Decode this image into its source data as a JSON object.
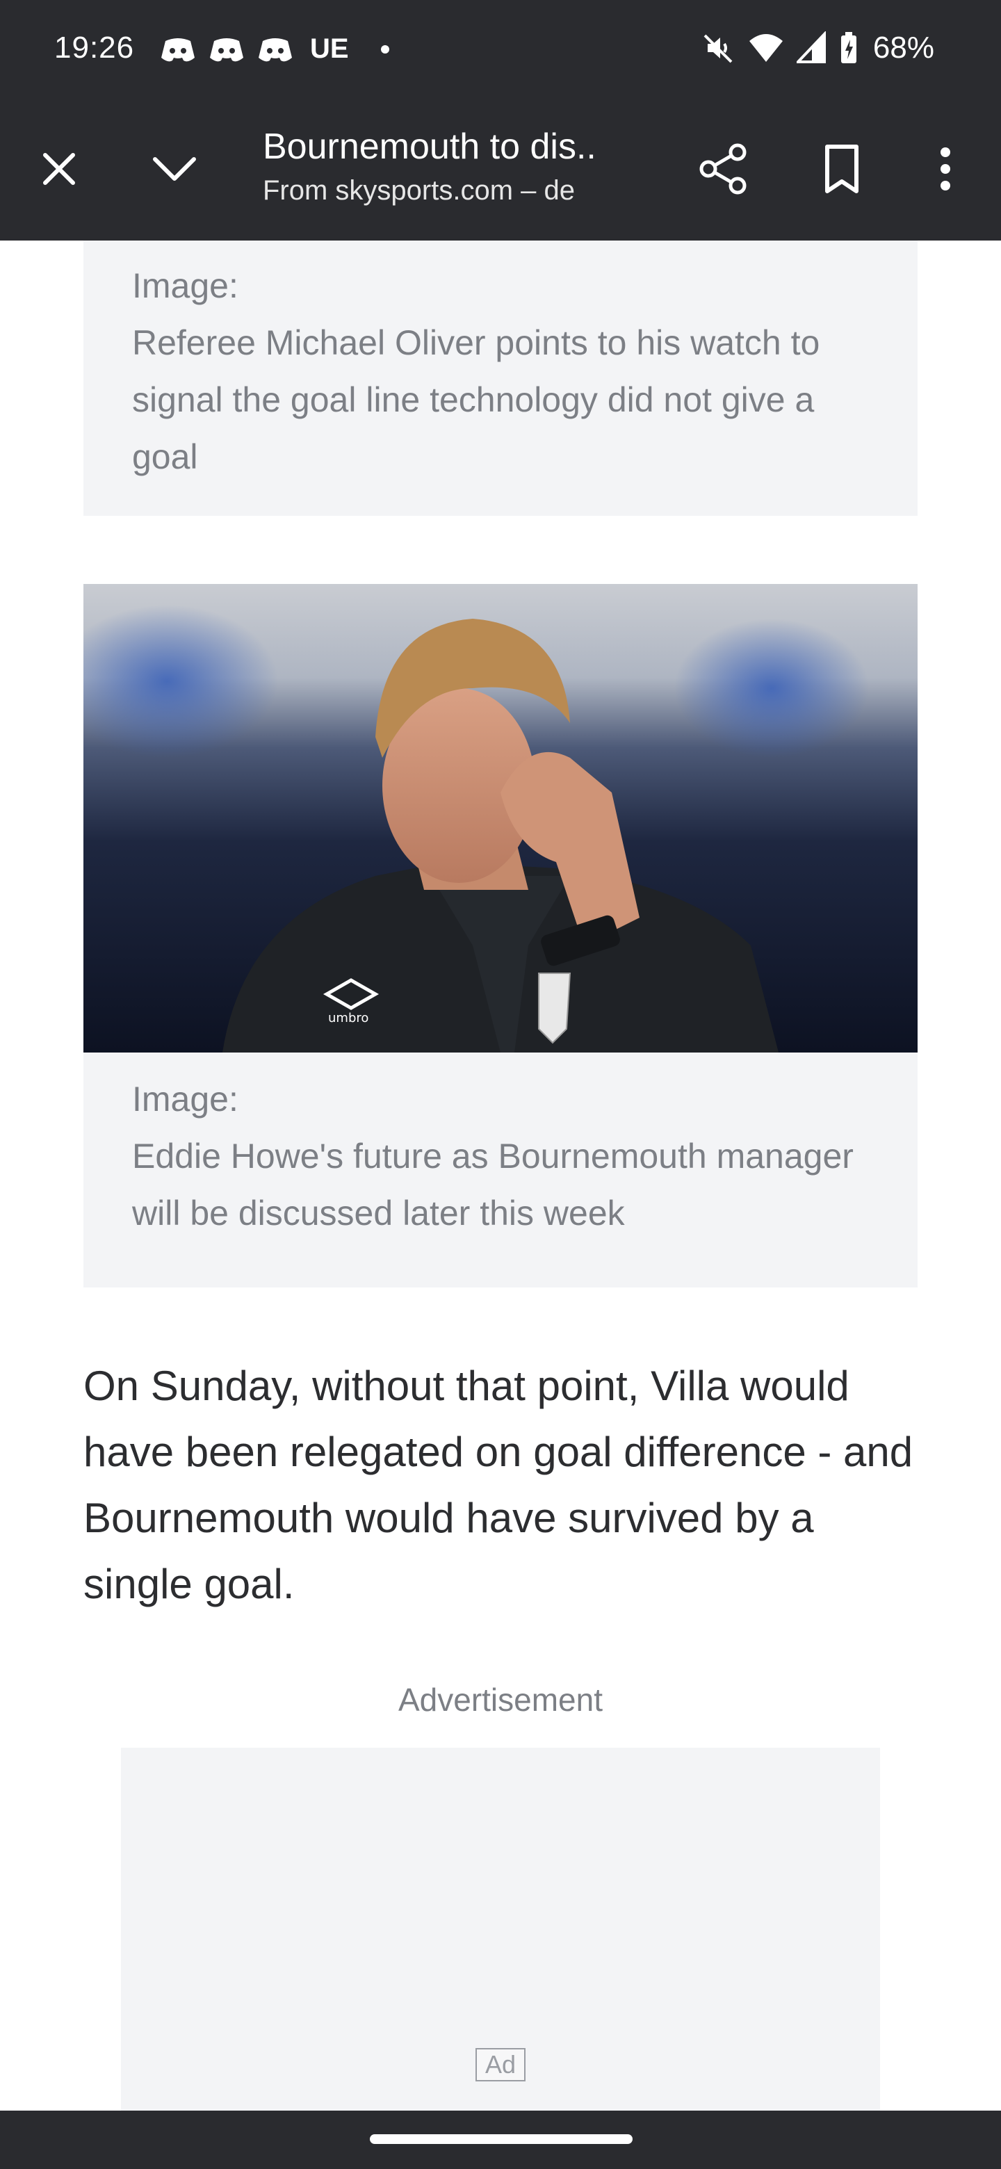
{
  "status_bar": {
    "time": "19:26",
    "carrier_text": "UE",
    "battery": "68%",
    "left_icons": [
      "discord-icon",
      "discord-icon",
      "discord-icon"
    ],
    "right_icons": [
      "mute-icon",
      "wifi-icon",
      "signal-icon",
      "battery-charging-icon"
    ]
  },
  "toolbar": {
    "title": "Bournemouth to dis...",
    "url": "From skysports.com – de",
    "icons": [
      "close-icon",
      "chevron-down-icon",
      "share-icon",
      "bookmark-icon",
      "more-vert-icon"
    ]
  },
  "captions": [
    {
      "label": "Image:",
      "text": "Referee Michael Oliver points to his watch to signal the goal line technology did not give a goal"
    },
    {
      "label": "Image:",
      "text": "Eddie Howe's future as Bournemouth manager will be discussed later this week"
    }
  ],
  "photo": {
    "logo_text": "umbro"
  },
  "article": {
    "paragraph": "On Sunday, without that point, Villa would have been relegated on goal difference - and Bournemouth would have survived by a single goal."
  },
  "ad": {
    "label": "Advertisement",
    "badge": "Ad"
  },
  "colors": {
    "chrome": "#2a2b2f",
    "caption_bg": "#f3f4f6",
    "caption_text": "#7c7f85",
    "body_text": "#2c2d30"
  }
}
